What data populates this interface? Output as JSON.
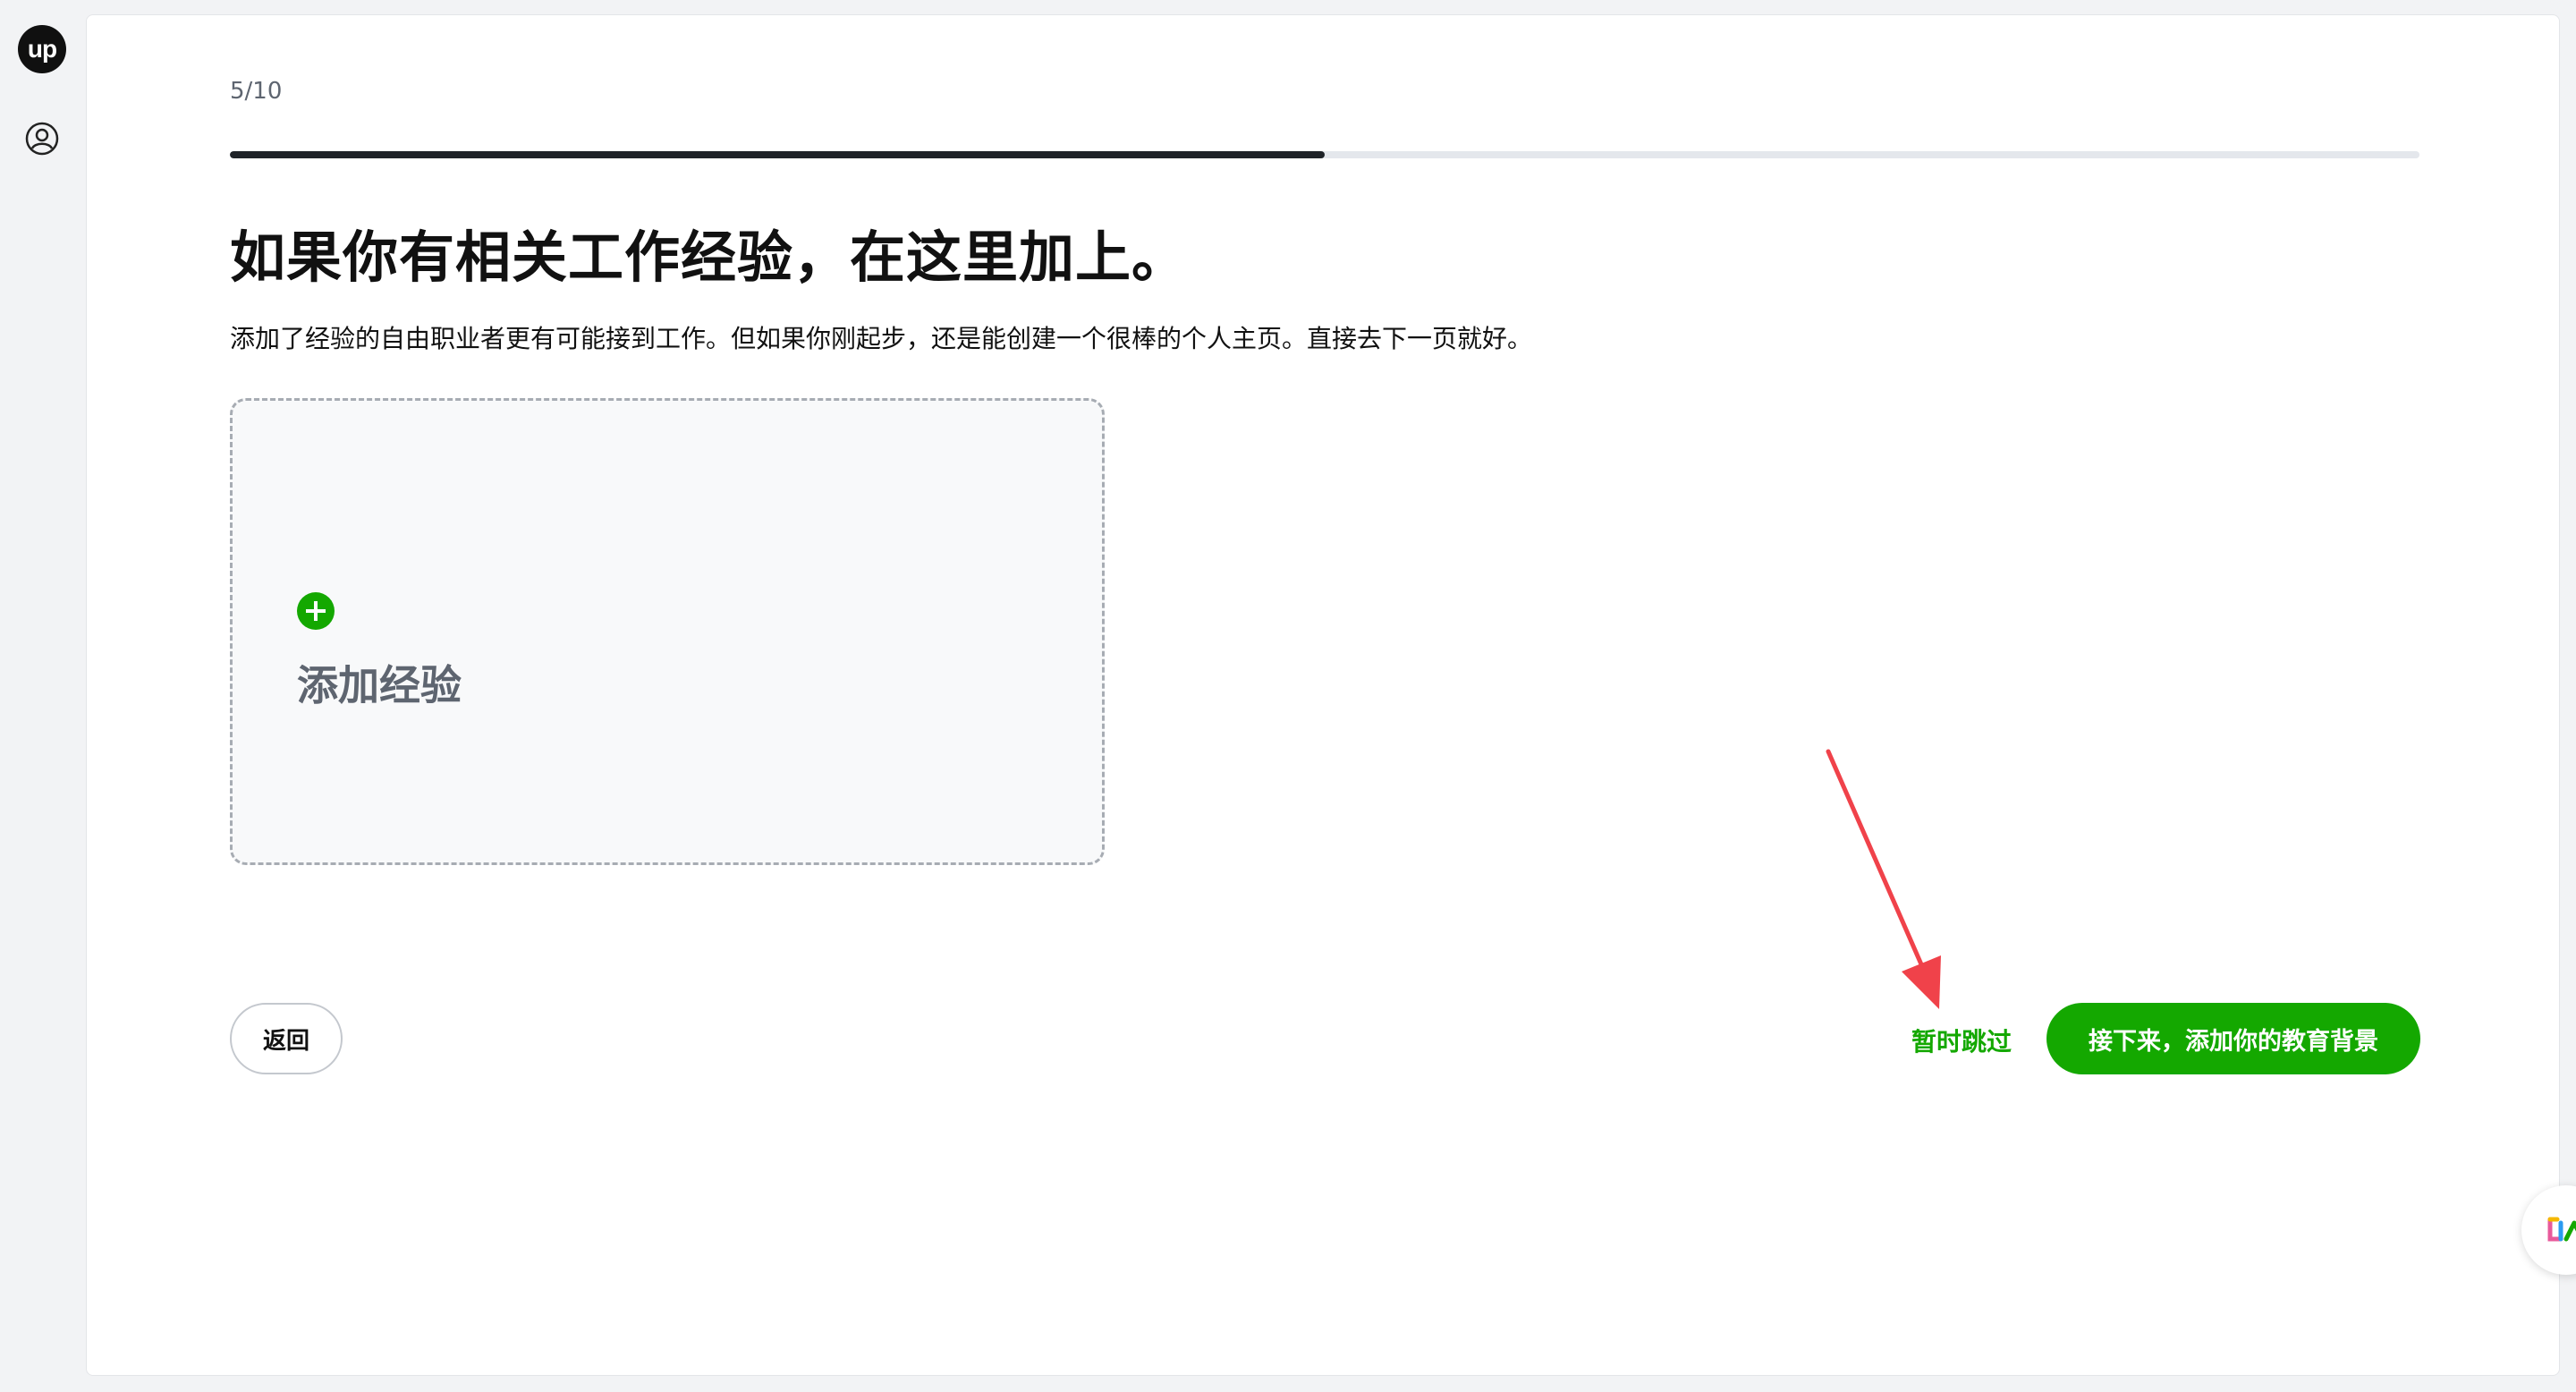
{
  "app": {
    "logo_text": "up"
  },
  "onboarding": {
    "step_count": "5/10",
    "progress": 0.5,
    "title": "如果你有相关工作经验，在这里加上。",
    "subtitle": "添加了经验的自由职业者更有可能接到工作。但如果你刚起步，还是能创建一个很棒的个人主页。直接去下一页就好。",
    "add_card_label": "添加经验"
  },
  "footer": {
    "back_label": "返回",
    "skip_label": "暂时跳过",
    "next_label": "接下来，添加你的教育背景"
  },
  "colors": {
    "accent": "#14a800",
    "annotation": "#f0424a",
    "progress_fill": "#1f2328"
  },
  "icons": {
    "logo": "upwork-logo-icon",
    "profile": "user-circle-icon",
    "add": "plus-circle-icon",
    "help": "help-assistant-icon"
  }
}
